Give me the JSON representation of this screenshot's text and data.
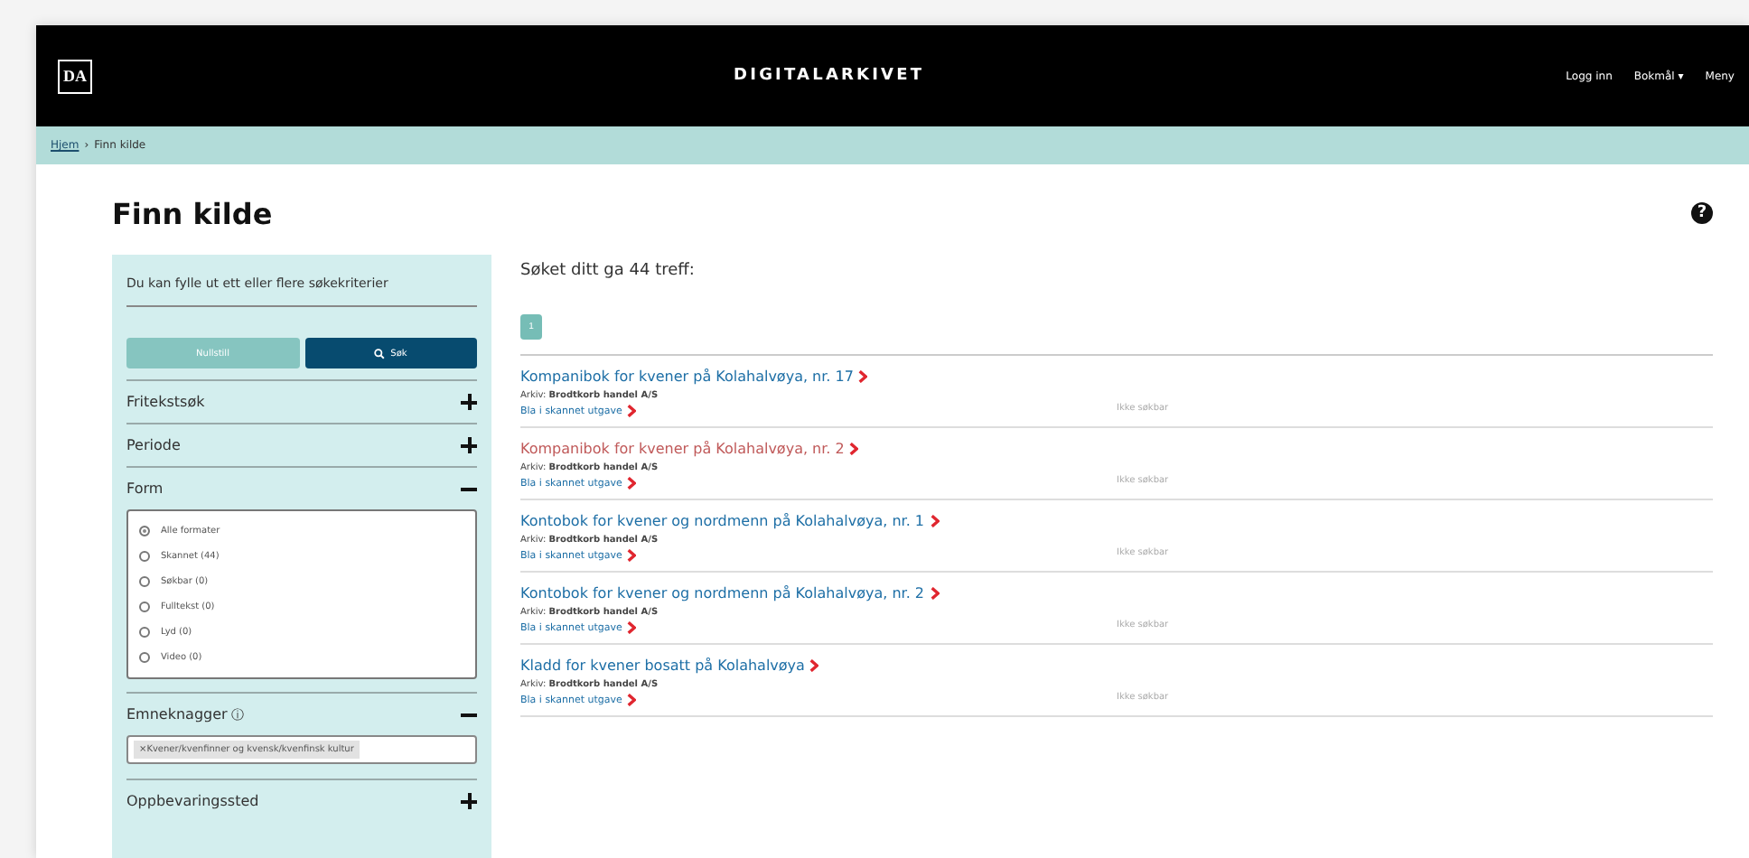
{
  "header": {
    "logo": "DA",
    "title": "DIGITALARKIVET",
    "nav": [
      "Logg inn",
      "Bokmål ▾",
      "Meny"
    ]
  },
  "breadcrumb": [
    {
      "label": "Hjem",
      "kind": "link"
    },
    {
      "label": "›",
      "kind": "separator"
    },
    {
      "label": "Finn kilde",
      "kind": "text"
    }
  ],
  "page_title": "Finn kilde",
  "help": "?",
  "sidebar": {
    "intro": "Du kan fylle ut ett eller flere søkekriterier",
    "buttons": [
      {
        "label": "Nullstill",
        "kind": "reset"
      },
      {
        "label": "Søk",
        "kind": "search"
      }
    ],
    "sections": [
      {
        "title": "Fritekstsøk",
        "expanded": false
      },
      {
        "title": "Periode",
        "expanded": false
      },
      {
        "title": "Form",
        "expanded": true,
        "kind": "radios",
        "options": [
          {
            "label": "Alle formater",
            "selected": true
          },
          {
            "label": "Skannet",
            "count": "(44)",
            "selected": false
          },
          {
            "label": "Søkbar",
            "count": "(0)",
            "selected": false
          },
          {
            "label": "Fulltekst",
            "count": "(0)",
            "selected": false
          },
          {
            "label": "Lyd",
            "count": "(0)",
            "selected": false
          },
          {
            "label": "Video",
            "count": "(0)",
            "selected": false
          }
        ]
      },
      {
        "title": "Emneknagger",
        "info": "ⓘ",
        "expanded": true,
        "kind": "tags",
        "tags": [
          "×Kvener/kvenfinner og kvensk/kvenfinsk kultur"
        ]
      },
      {
        "title": "Oppbevaringssted",
        "expanded": false
      }
    ]
  },
  "results": {
    "summary": "Søket ditt ga 44 treff:",
    "pages": [
      {
        "label": "1",
        "selected": true
      }
    ],
    "items": [
      {
        "title": "Kompanibok for kvener på Kolahalvøya, nr. 17",
        "visited": false,
        "archive_label": "Arkiv:",
        "archive": "Brodtkorb handel A/S",
        "browse": "Bla i skannet utgave",
        "status": "Ikke søkbar"
      },
      {
        "title": "Kompanibok for kvener på Kolahalvøya, nr. 2",
        "visited": true,
        "archive_label": "Arkiv:",
        "archive": "Brodtkorb handel A/S",
        "browse": "Bla i skannet utgave",
        "status": "Ikke søkbar"
      },
      {
        "title": "Kontobok for kvener og nordmenn på Kolahalvøya, nr. 1",
        "visited": false,
        "archive_label": "Arkiv:",
        "archive": "Brodtkorb handel A/S",
        "browse": "Bla i skannet utgave",
        "status": "Ikke søkbar"
      },
      {
        "title": "Kontobok for kvener og nordmenn på Kolahalvøya, nr. 2",
        "visited": false,
        "archive_label": "Arkiv:",
        "archive": "Brodtkorb handel A/S",
        "browse": "Bla i skannet utgave",
        "status": "Ikke søkbar"
      },
      {
        "title": "Kladd for kvener bosatt på Kolahalvøya",
        "visited": false,
        "archive_label": "Arkiv:",
        "archive": "Brodtkorb handel A/S",
        "browse": "Bla i skannet utgave",
        "status": "Ikke søkbar"
      }
    ]
  }
}
